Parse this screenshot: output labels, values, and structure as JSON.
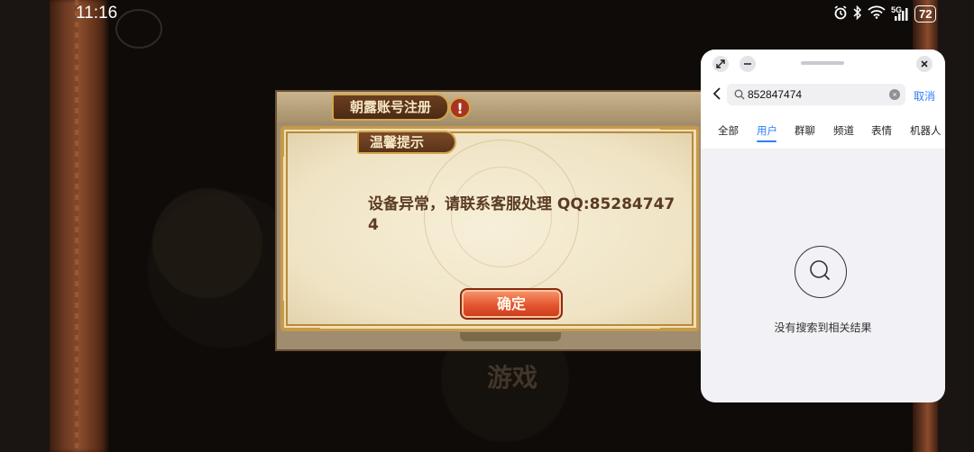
{
  "status_bar": {
    "time": "11:16",
    "network": "5G",
    "battery": "72"
  },
  "game": {
    "watermark": "游戏",
    "dialog": {
      "header_title": "朝露账号注册",
      "tip_title": "温馨提示",
      "message": "设备异常，请联系客服处理 QQ:852847474",
      "confirm_label": "确定"
    }
  },
  "qq_search": {
    "query": "852847474",
    "cancel_label": "取消",
    "tabs": [
      {
        "label": "全部",
        "active": false
      },
      {
        "label": "用户",
        "active": true
      },
      {
        "label": "群聊",
        "active": false
      },
      {
        "label": "频道",
        "active": false
      },
      {
        "label": "表情",
        "active": false
      },
      {
        "label": "机器人",
        "active": false
      }
    ],
    "empty_text": "没有搜索到相关结果",
    "accent": "#2d7ff9"
  }
}
